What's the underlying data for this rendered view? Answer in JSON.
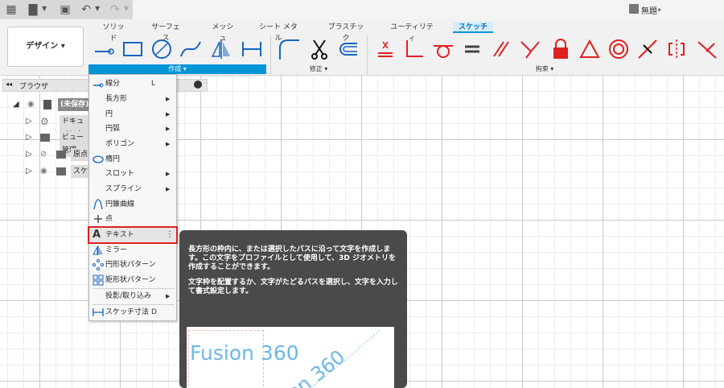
{
  "app": {
    "doc_title": "無題*"
  },
  "ribbon": {
    "workspace": "デザイン ▾",
    "tabs": [
      {
        "label": "ソリッド"
      },
      {
        "label": "サーフェス"
      },
      {
        "label": "メッシュ"
      },
      {
        "label": "シート メタル"
      },
      {
        "label": "プラスチック"
      },
      {
        "label": "ユーティリティ"
      },
      {
        "label": "スケッチ",
        "active": true
      }
    ],
    "groups": {
      "create": "作成 ▾",
      "modify": "修正 ▾",
      "constraints": "拘束 ▾"
    }
  },
  "browser": {
    "title": "ブラウザ",
    "items": [
      {
        "label": "(未保存)"
      },
      {
        "label": "ドキュメント"
      },
      {
        "label": "ビュー管理"
      },
      {
        "label": "原点"
      },
      {
        "label": "スケ"
      }
    ]
  },
  "menu": {
    "items": [
      {
        "label": "線分",
        "shortcut": "L"
      },
      {
        "label": "長方形",
        "submenu": true
      },
      {
        "label": "円",
        "submenu": true
      },
      {
        "label": "円弧",
        "submenu": true
      },
      {
        "label": "ポリゴン",
        "submenu": true
      },
      {
        "label": "楕円"
      },
      {
        "label": "スロット",
        "submenu": true
      },
      {
        "label": "スプライン",
        "submenu": true
      },
      {
        "label": "円錐曲線"
      },
      {
        "label": "点"
      },
      {
        "label": "テキスト",
        "highlighted": true
      },
      {
        "label": "ミラー"
      },
      {
        "label": "円形状パターン"
      },
      {
        "label": "矩形状パターン"
      },
      {
        "label": "投影/取り込み",
        "submenu": true
      },
      {
        "label": "スケッチ寸法",
        "shortcut": "D"
      }
    ]
  },
  "tooltip": {
    "p1": "長方形の枠内に、または選択したパスに沿って文字を作成します。この文字をプロファイルとして使用して、3D ジオメトリを作成することができます。",
    "p2": "文字枠を配置するか、文字がたどるパスを選択し、文字を入力して書式設定します。",
    "sample_text": "Fusion 360",
    "path_text": "on 360"
  },
  "colors": {
    "accent": "#0696d7",
    "highlight": "#e02020",
    "tooltip_bg": "#4a4a4a",
    "sample_text": "#6cb8e6"
  }
}
